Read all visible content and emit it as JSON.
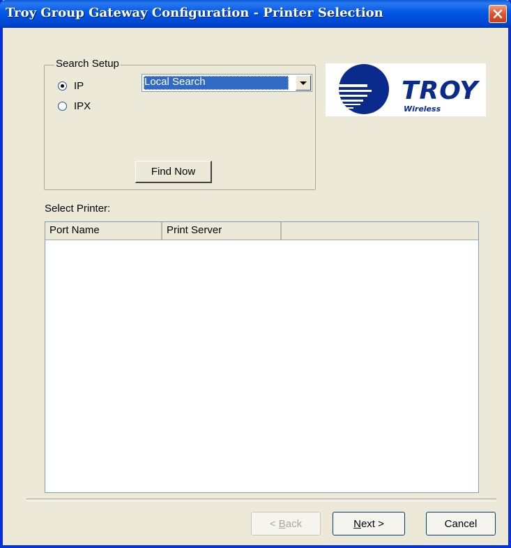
{
  "window": {
    "title": "Troy Group Gateway Configuration - Printer Selection"
  },
  "search_setup": {
    "legend": "Search Setup",
    "protocols": [
      {
        "label": "IP",
        "checked": true
      },
      {
        "label": "IPX",
        "checked": false
      }
    ],
    "search_type": "Local Search",
    "find_now_label": "Find Now"
  },
  "logo": {
    "brand": "TROY",
    "tagline": "Wireless"
  },
  "printer_list": {
    "label": "Select Printer:",
    "columns": [
      "Port Name",
      "Print Server"
    ],
    "rows": []
  },
  "footer": {
    "back_pre": "< ",
    "back_key": "B",
    "back_rest": "ack",
    "next_key": "N",
    "next_rest": "ext >",
    "cancel_label": "Cancel"
  },
  "colors": {
    "title_bar": "#0058e6",
    "dialog_bg": "#ece9d8",
    "selection": "#316ac5",
    "logo_blue": "#0a2a8c"
  }
}
